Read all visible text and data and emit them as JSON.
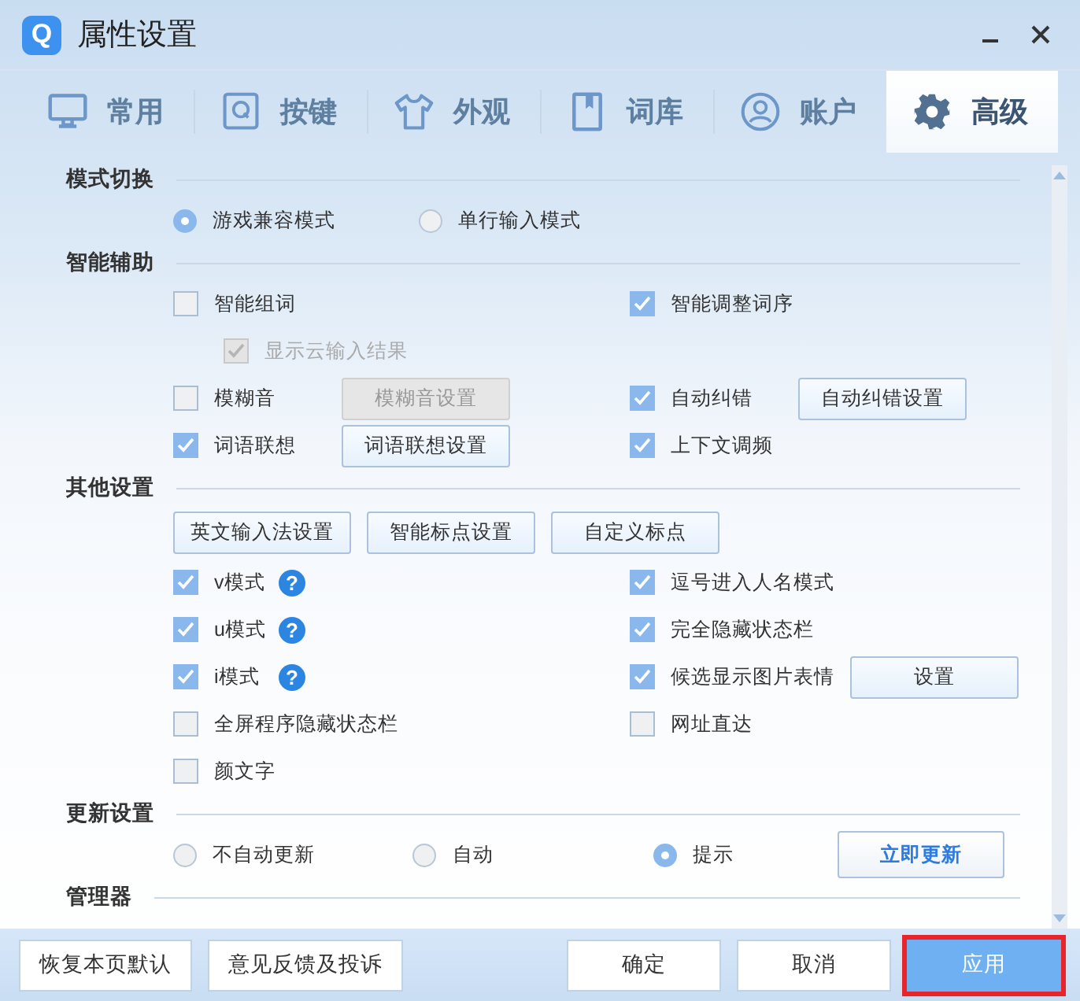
{
  "window": {
    "title": "属性设置",
    "logo": "Q"
  },
  "tabs": [
    {
      "label": "常用",
      "selected": false
    },
    {
      "label": "按键",
      "selected": false
    },
    {
      "label": "外观",
      "selected": false
    },
    {
      "label": "词库",
      "selected": false
    },
    {
      "label": "账户",
      "selected": false
    },
    {
      "label": "高级",
      "selected": true
    }
  ],
  "sections": [
    {
      "title": "模式切换",
      "rows": [
        {
          "kind": "radios",
          "items": [
            {
              "kind": "radio",
              "label": "游戏兼容模式",
              "selected": true
            },
            {
              "kind": "radio",
              "label": "单行输入模式",
              "selected": false
            }
          ]
        }
      ]
    },
    {
      "title": "智能辅助",
      "rows": [
        {
          "kind": "pair",
          "left": [
            {
              "kind": "checkbox",
              "label": "智能组词",
              "checked": false
            }
          ],
          "right": [
            {
              "kind": "checkbox",
              "label": "智能调整词序",
              "checked": true
            }
          ]
        },
        {
          "kind": "indent",
          "left": [
            {
              "kind": "checkbox",
              "label": "显示云输入结果",
              "checked": true,
              "disabled": true
            }
          ]
        },
        {
          "kind": "pair",
          "left": [
            {
              "kind": "checkbox",
              "label": "模糊音",
              "checked": false
            },
            {
              "kind": "button",
              "label": "模糊音设置",
              "disabled": true
            }
          ],
          "right": [
            {
              "kind": "checkbox",
              "label": "自动纠错",
              "checked": true
            },
            {
              "kind": "button",
              "label": "自动纠错设置",
              "disabled": false
            }
          ]
        },
        {
          "kind": "pair",
          "left": [
            {
              "kind": "checkbox",
              "label": "词语联想",
              "checked": true
            },
            {
              "kind": "button",
              "label": "词语联想设置",
              "disabled": false
            }
          ],
          "right": [
            {
              "kind": "checkbox",
              "label": "上下文调频",
              "checked": true
            }
          ]
        }
      ]
    },
    {
      "title": "其他设置",
      "rows": [
        {
          "kind": "buttons",
          "items": [
            {
              "kind": "button",
              "label": "英文输入法设置",
              "disabled": false
            },
            {
              "kind": "button",
              "label": "智能标点设置",
              "disabled": false
            },
            {
              "kind": "button",
              "label": "自定义标点",
              "disabled": false
            }
          ]
        },
        {
          "kind": "pair",
          "left": [
            {
              "kind": "checkbox",
              "label": "v模式",
              "checked": true,
              "help": "?"
            }
          ],
          "right": [
            {
              "kind": "checkbox",
              "label": "逗号进入人名模式",
              "checked": true
            }
          ]
        },
        {
          "kind": "pair",
          "left": [
            {
              "kind": "checkbox",
              "label": "u模式",
              "checked": true,
              "help": "?"
            }
          ],
          "right": [
            {
              "kind": "checkbox",
              "label": "完全隐藏状态栏",
              "checked": true
            }
          ]
        },
        {
          "kind": "pair",
          "left": [
            {
              "kind": "checkbox",
              "label": "i模式",
              "checked": true,
              "help": "?"
            }
          ],
          "right": [
            {
              "kind": "checkbox",
              "label": "候选显示图片表情",
              "checked": true
            },
            {
              "kind": "button",
              "label": "设置",
              "disabled": false
            }
          ]
        },
        {
          "kind": "pair",
          "left": [
            {
              "kind": "checkbox",
              "label": "全屏程序隐藏状态栏",
              "checked": false
            }
          ],
          "right": [
            {
              "kind": "checkbox",
              "label": "网址直达",
              "checked": false
            }
          ]
        },
        {
          "kind": "pair",
          "left": [
            {
              "kind": "checkbox",
              "label": "颜文字",
              "checked": false
            }
          ],
          "right": []
        }
      ]
    },
    {
      "title": "更新设置",
      "rows": [
        {
          "kind": "radios",
          "items": [
            {
              "kind": "radio",
              "label": "不自动更新",
              "selected": false
            },
            {
              "kind": "radio",
              "label": "自动",
              "selected": false
            },
            {
              "kind": "radio",
              "label": "提示",
              "selected": true
            },
            {
              "kind": "button",
              "label": "立即更新",
              "disabled": false,
              "accent": true
            }
          ]
        }
      ]
    },
    {
      "title": "管理器"
    }
  ],
  "footer": {
    "left": [
      {
        "label": "恢复本页默认",
        "primary": false,
        "highlighted": false
      },
      {
        "label": "意见反馈及投诉",
        "primary": false,
        "highlighted": false
      }
    ],
    "right": [
      {
        "label": "确定",
        "primary": false,
        "highlighted": false
      },
      {
        "label": "取消",
        "primary": false,
        "highlighted": false
      },
      {
        "label": "应用",
        "primary": true,
        "highlighted": true
      }
    ]
  }
}
